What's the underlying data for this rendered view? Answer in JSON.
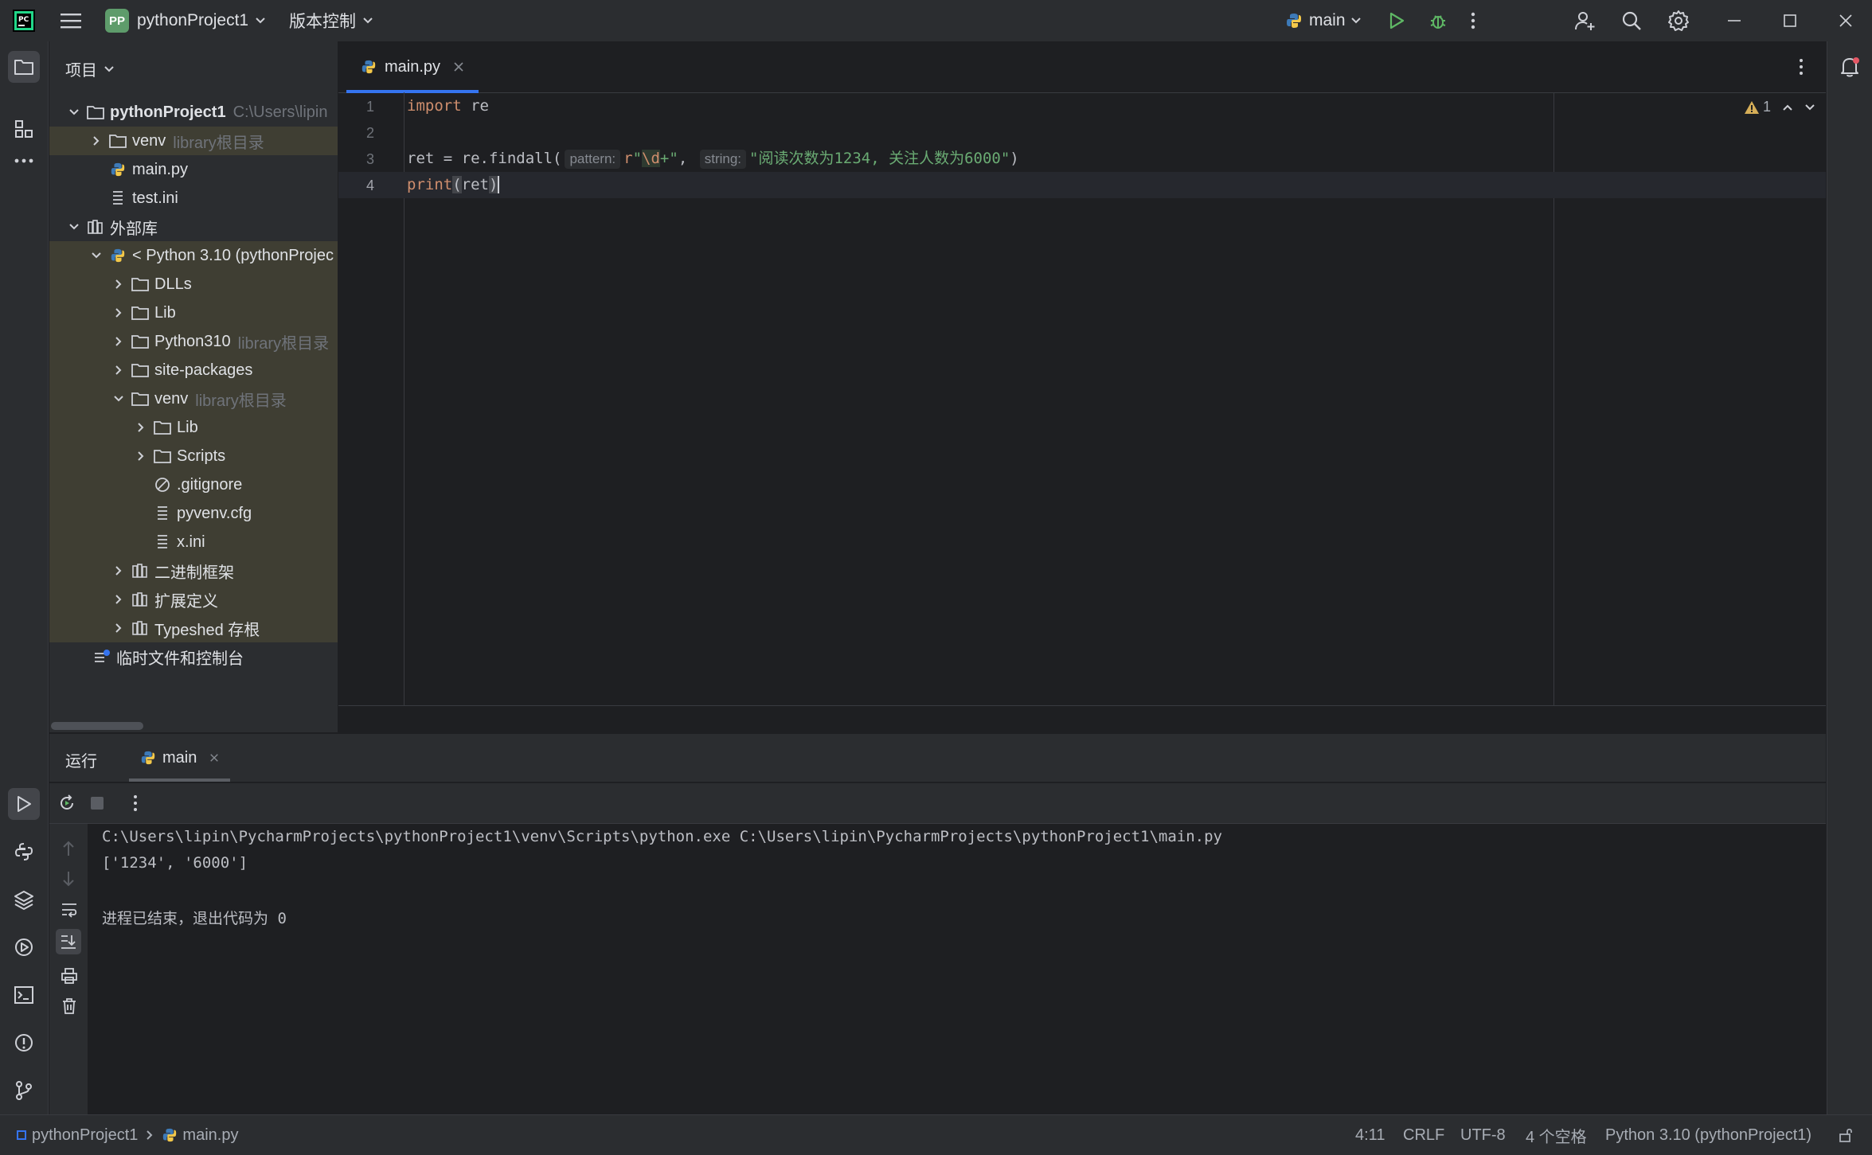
{
  "titlebar": {
    "project_badge": "PP",
    "project_name": "pythonProject1",
    "vcs_label": "版本控制",
    "run_config": "main"
  },
  "project_panel": {
    "title": "项目",
    "items": [
      {
        "label": "pythonProject1",
        "hint": "C:\\Users\\lipin"
      },
      {
        "label": "venv",
        "hint": "library根目录"
      },
      {
        "label": "main.py",
        "hint": ""
      },
      {
        "label": "test.ini",
        "hint": ""
      },
      {
        "label": "外部库",
        "hint": ""
      },
      {
        "label": "< Python 3.10 (pythonProjec",
        "hint": ""
      },
      {
        "label": "DLLs",
        "hint": ""
      },
      {
        "label": "Lib",
        "hint": ""
      },
      {
        "label": "Python310",
        "hint": "library根目录"
      },
      {
        "label": "site-packages",
        "hint": ""
      },
      {
        "label": "venv",
        "hint": "library根目录"
      },
      {
        "label": "Lib",
        "hint": ""
      },
      {
        "label": "Scripts",
        "hint": ""
      },
      {
        "label": ".gitignore",
        "hint": ""
      },
      {
        "label": "pyvenv.cfg",
        "hint": ""
      },
      {
        "label": "x.ini",
        "hint": ""
      },
      {
        "label": "二进制框架",
        "hint": ""
      },
      {
        "label": "扩展定义",
        "hint": ""
      },
      {
        "label": "Typeshed 存根",
        "hint": ""
      },
      {
        "label": "临时文件和控制台",
        "hint": ""
      }
    ]
  },
  "editor": {
    "tab_label": "main.py",
    "line_numbers": [
      "1",
      "2",
      "3",
      "4"
    ],
    "code": {
      "l1_kw": "import",
      "l1_rest": " re",
      "l3_pre": "ret = re.findall(",
      "l3_hint1": "pattern:",
      "l3_prefix": "r",
      "l3_q1": "\"",
      "l3_esc": "\\d",
      "l3_plus": "+",
      "l3_q2": "\"",
      "l3_comma": ", ",
      "l3_hint2": "string:",
      "l3_str": "\"阅读次数为1234, 关注人数为6000\"",
      "l3_close": ")",
      "l4_fn": "print",
      "l4_open": "(",
      "l4_arg": "ret",
      "l4_close": ")"
    },
    "warning_count": "1"
  },
  "run_panel": {
    "tab_run": "运行",
    "tab_main": "main",
    "console": [
      "C:\\Users\\lipin\\PycharmProjects\\pythonProject1\\venv\\Scripts\\python.exe C:\\Users\\lipin\\PycharmProjects\\pythonProject1\\main.py",
      "['1234', '6000']",
      "",
      "进程已结束，退出代码为 0"
    ]
  },
  "statusbar": {
    "breadcrumb_project": "pythonProject1",
    "breadcrumb_file": "main.py",
    "position": "4:11",
    "line_sep": "CRLF",
    "encoding": "UTF-8",
    "indent": "4 个空格",
    "interpreter": "Python 3.10 (pythonProject1)"
  },
  "colors": {
    "accent": "#3574f0",
    "keyword": "#cf8e6d",
    "string": "#6aab73",
    "run_green": "#5fb865",
    "selection": "#3f3e33"
  }
}
